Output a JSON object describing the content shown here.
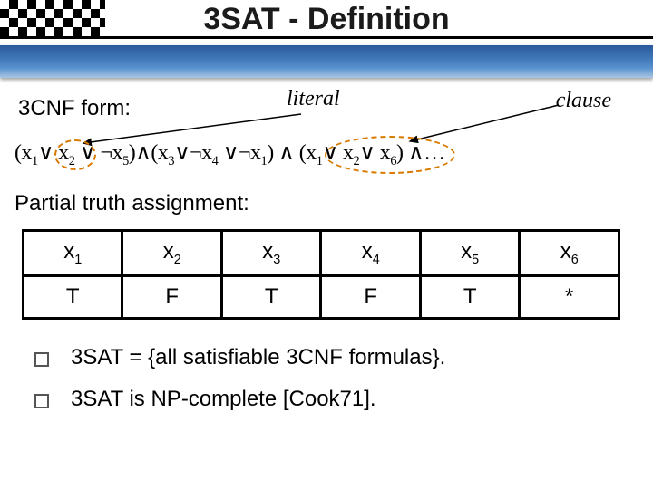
{
  "title": "3SAT - Definition",
  "labels": {
    "cnf": "3CNF form:",
    "literal": "literal",
    "clause": "clause",
    "partial": "Partial truth assignment:"
  },
  "formula": {
    "tokens": [
      {
        "t": "(x",
        "sub": "1"
      },
      {
        "t": "∨ x",
        "sub": "2"
      },
      {
        "t": " ∨ ¬x",
        "sub": "5"
      },
      {
        "t": ")∧(x",
        "sub": "3"
      },
      {
        "t": "∨¬x",
        "sub": "4"
      },
      {
        "t": " ∨¬x",
        "sub": "1"
      },
      {
        "t": ") ∧ (x",
        "sub": "1"
      },
      {
        "t": "∨ x",
        "sub": "2"
      },
      {
        "t": "∨ x",
        "sub": "6"
      },
      {
        "t": ") ∧…",
        "sub": ""
      }
    ]
  },
  "table": {
    "headers": [
      "x1",
      "x2",
      "x3",
      "x4",
      "x5",
      "x6"
    ],
    "values": [
      "T",
      "F",
      "T",
      "F",
      "T",
      "*"
    ]
  },
  "bullets": {
    "b1": "3SAT = {all satisfiable 3CNF formulas}.",
    "b2": "3SAT is NP-complete [Cook71]."
  }
}
